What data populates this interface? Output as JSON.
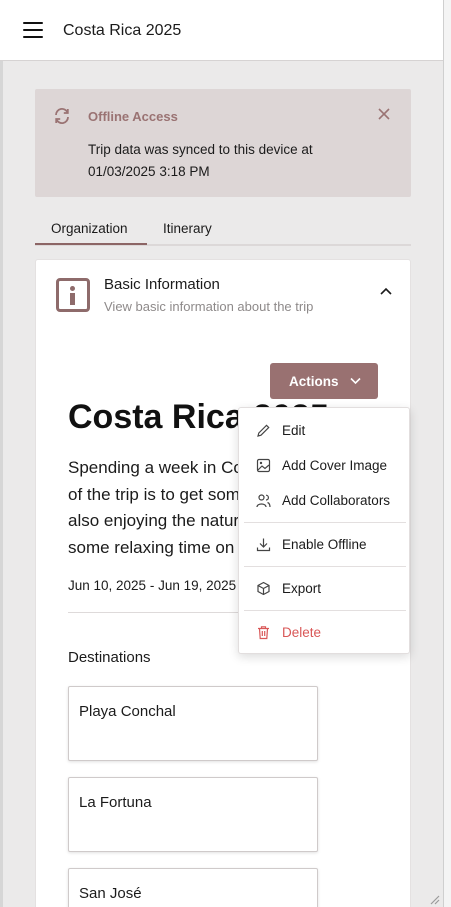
{
  "app": {
    "title": "Costa Rica 2025"
  },
  "banner": {
    "title": "Offline Access",
    "message": "Trip data was synced to this device at 01/03/2025 3:18 PM"
  },
  "tabs": [
    {
      "label": "Organization",
      "active": true
    },
    {
      "label": "Itinerary",
      "active": false
    }
  ],
  "section": {
    "title": "Basic Information",
    "subtitle": "View basic information about the trip",
    "actions_label": "Actions"
  },
  "trip": {
    "title": "Costa Rica 2025",
    "description": "Spending a week in Costa Rica. The goal of the trip is to get some city action, while also enjoying the natural rainforest and some relaxing time on the beach.",
    "dates": "Jun 10, 2025 - Jun 19, 2025"
  },
  "destinations": {
    "label": "Destinations",
    "items": [
      "Playa Conchal",
      "La Fortuna",
      "San José"
    ]
  },
  "actions_menu": {
    "items": [
      {
        "label": "Edit",
        "icon": "pencil-icon"
      },
      {
        "label": "Add Cover Image",
        "icon": "image-icon"
      },
      {
        "label": "Add Collaborators",
        "icon": "users-icon"
      },
      {
        "label": "Enable Offline",
        "icon": "download-icon"
      },
      {
        "label": "Export",
        "icon": "export-icon"
      },
      {
        "label": "Delete",
        "icon": "trash-icon"
      }
    ]
  },
  "colors": {
    "accent": "#997171",
    "banner_bg": "#ddd6d6",
    "danger": "#d95757"
  }
}
